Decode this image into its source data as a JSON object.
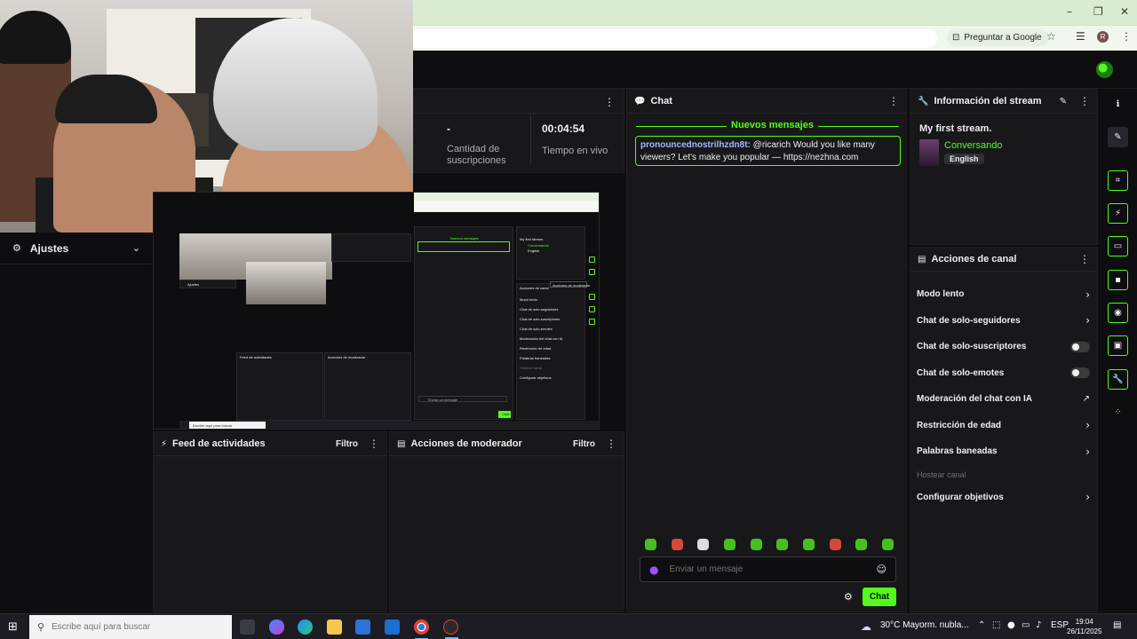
{
  "browser": {
    "window_controls": [
      "–",
      "❐",
      "✕"
    ],
    "ask_google": "Preguntar a Google"
  },
  "left": {
    "ajustes_label": "Ajustes"
  },
  "stats": {
    "subs_value": "-",
    "subs_label": "Cantidad de suscripciones",
    "live_value": "00:04:54",
    "live_label": "Tiempo en vivo"
  },
  "chat": {
    "title": "Chat",
    "new_messages": "Nuevos mensajes",
    "message": {
      "user": "pronouncednostrilhzdn8t:",
      "text": " @ricarich Would you like many viewers? Let's make you popular — https://nezhna.com"
    },
    "input_placeholder": "Enviar un mensaje",
    "send_label": "Chat"
  },
  "stream_info": {
    "header": "Información del stream",
    "title": "My first stream.",
    "category": "Conversando",
    "language": "English"
  },
  "channel_actions": {
    "header": "Acciones de canal",
    "items": [
      {
        "label": "Modo lento",
        "control": "chevron"
      },
      {
        "label": "Chat de solo-seguidores",
        "control": "chevron"
      },
      {
        "label": "Chat de solo-suscriptores",
        "control": "toggle"
      },
      {
        "label": "Chat de solo-emotes",
        "control": "toggle"
      },
      {
        "label": "Moderación del chat con IA",
        "control": "external"
      },
      {
        "label": "Restricción de edad",
        "control": "chevron"
      },
      {
        "label": "Palabras baneadas",
        "control": "chevron"
      },
      {
        "label": "Hostear canal",
        "control": "none"
      },
      {
        "label": "Configurar objetivos",
        "control": "chevron"
      }
    ]
  },
  "bottom": {
    "feed_title": "Feed de actividades",
    "feed_filter": "Filtro",
    "mod_title": "Acciones de moderador",
    "mod_filter": "Filtro"
  },
  "mirror": {
    "new_messages": "Nuevos mensajes",
    "tooltip": "Acciones de moderador",
    "stream_title": "My first stream.",
    "category": "Conversando",
    "language": "English",
    "canal_header": "Acciones de canal",
    "items": [
      "Modo lento",
      "Chat de solo-seguidores",
      "Chat de solo-suscriptores",
      "Chat de solo-emotes",
      "Moderación del chat con IA",
      "Restricción de edad",
      "Palabras baneadas",
      "Hostear canal",
      "Configurar objetivos"
    ],
    "feed": "Feed de actividades",
    "mod": "Acciones de moderador",
    "input": "Enviar un mensaje",
    "send": "Chat",
    "ajustes": "Ajustes",
    "search": "Escribe aquí para buscar"
  },
  "taskbar": {
    "search_placeholder": "Escribe aquí para buscar",
    "weather": "30°C  Mayorm. nubla...",
    "lang": "ESP",
    "time": "19:04",
    "date": "26/11/2025"
  },
  "colors": {
    "accent": "#53fc18",
    "background": "#0e0e10",
    "panel": "#18181b"
  }
}
